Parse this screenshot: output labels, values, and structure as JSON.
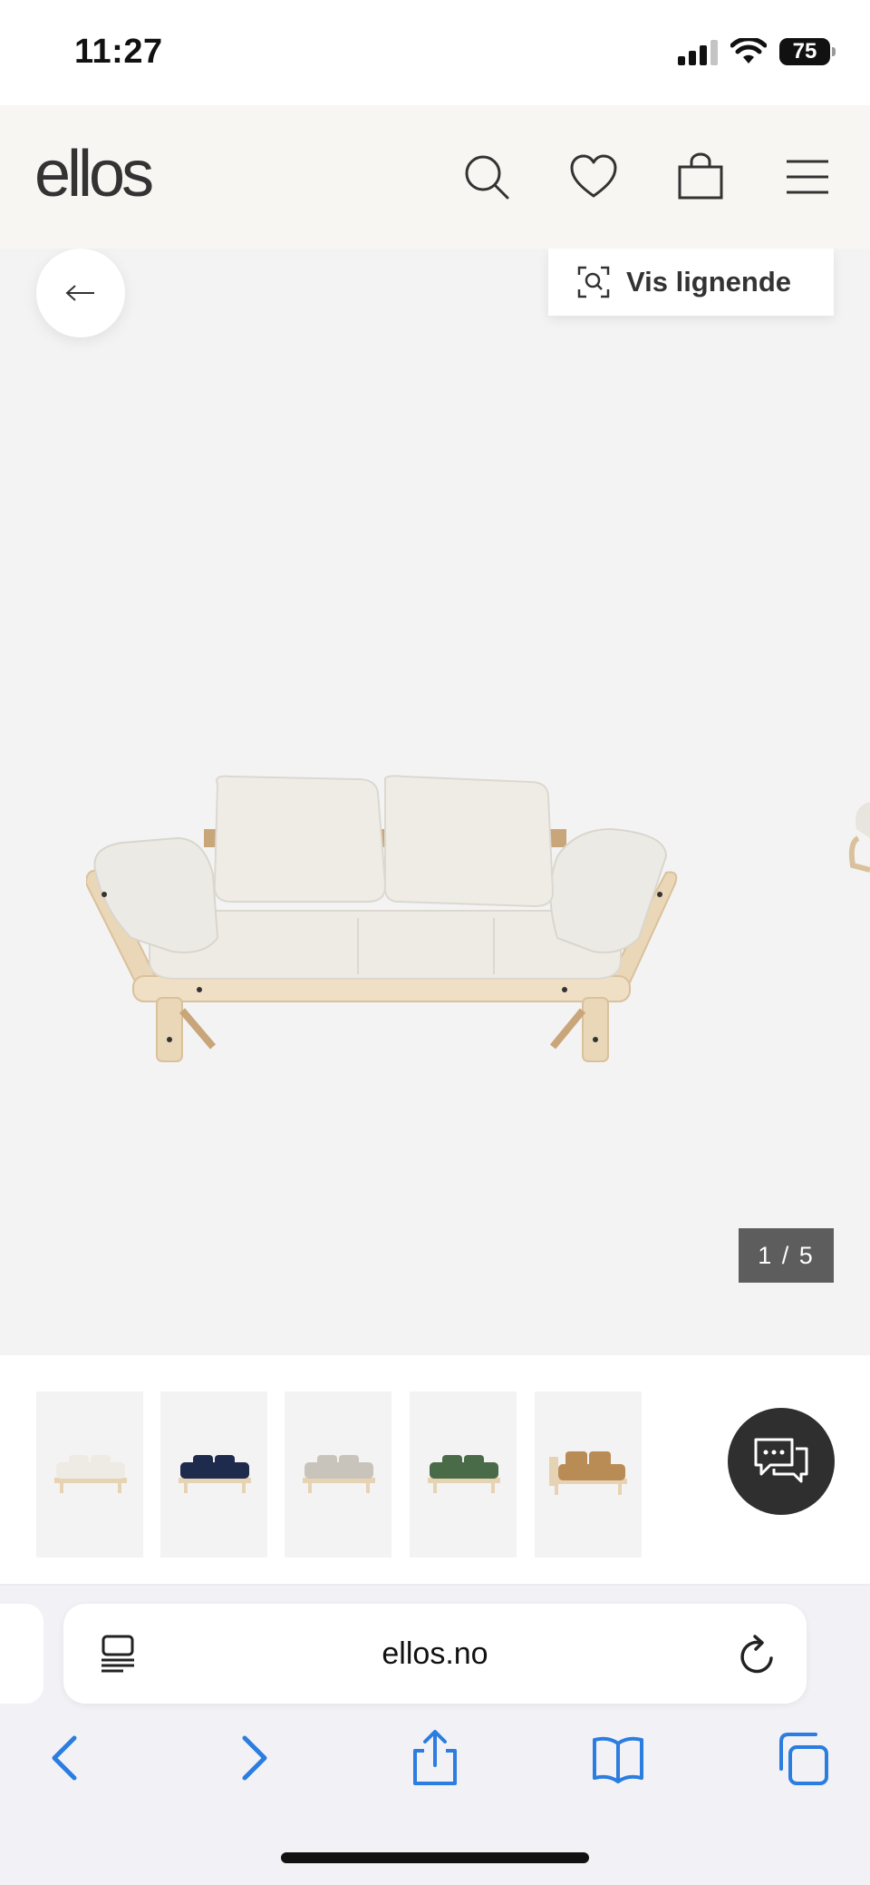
{
  "status_bar": {
    "time": "11:27",
    "battery": "75"
  },
  "header": {
    "logo": "ellos"
  },
  "gallery": {
    "similar_label": "Vis lignende",
    "counter": "1 / 5"
  },
  "thumbnails": [
    {
      "color": "#eeebe4"
    },
    {
      "color": "#1f2b4d"
    },
    {
      "color": "#c9c4bb"
    },
    {
      "color": "#4a6b47"
    },
    {
      "color": "#b98c55"
    }
  ],
  "browser": {
    "url": "ellos.no"
  },
  "colors": {
    "accent": "#2b7de0",
    "chat_bg": "#2f2f2f"
  }
}
